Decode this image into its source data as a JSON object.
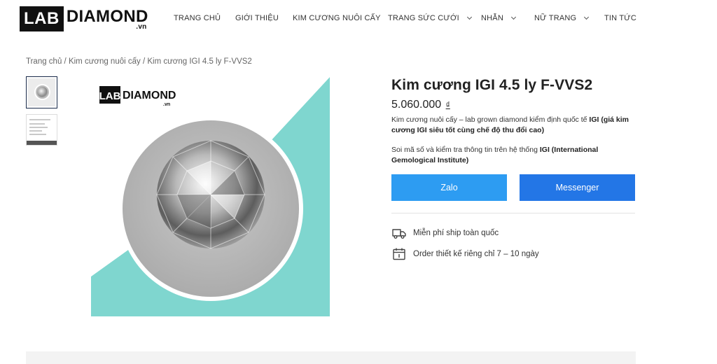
{
  "brand": {
    "logo_lab": "LAB",
    "logo_diamond": "DIAMOND",
    "logo_suffix": ".vn"
  },
  "nav": {
    "items": [
      {
        "label": "TRANG CHỦ",
        "dropdown": false
      },
      {
        "label": "GIỚI THIỆU",
        "dropdown": false
      },
      {
        "label": "KIM CƯƠNG NUÔI CẤY",
        "dropdown": false
      },
      {
        "label": "TRANG SỨC CƯỚI",
        "dropdown": true
      },
      {
        "label": "NHẪN",
        "dropdown": true
      },
      {
        "label": "NỮ TRANG",
        "dropdown": true
      },
      {
        "label": "TIN TỨC",
        "dropdown": false
      }
    ]
  },
  "breadcrumb": {
    "home": "Trang chủ",
    "category": "Kim cương nuôi cấy",
    "current": "Kim cương IGI 4.5 ly F-VVS2",
    "separator": " / "
  },
  "gallery": {
    "image_logo_lab": "LAB",
    "image_logo_diamond": "DIAMOND",
    "image_logo_suffix": ".vn",
    "accent_color": "#7fd6cf"
  },
  "product": {
    "title": "Kim cương IGI 4.5 ly F-VVS2",
    "price": "5.060.000",
    "currency": "₫",
    "desc1_text": "Kim cương nuôi cấy – lab grown diamond kiểm định quốc tế ",
    "desc1_bold": "IGI (giá kim cương IGI siêu tốt cùng chế độ thu đổi cao)",
    "desc2_text": "Soi mã số và kiểm tra thông tin trên hệ thống ",
    "desc2_bold": "IGI (International Gemological Institute)"
  },
  "actions": {
    "zalo_label": "Zalo",
    "zalo_color": "#2d9cf2",
    "messenger_label": "Messenger",
    "messenger_color": "#2376e6"
  },
  "features": [
    {
      "icon": "truck-icon",
      "label": "Miễn phí ship toàn quốc"
    },
    {
      "icon": "calendar-icon",
      "label": "Order thiết kế riêng chỉ 7 – 10 ngày"
    }
  ]
}
